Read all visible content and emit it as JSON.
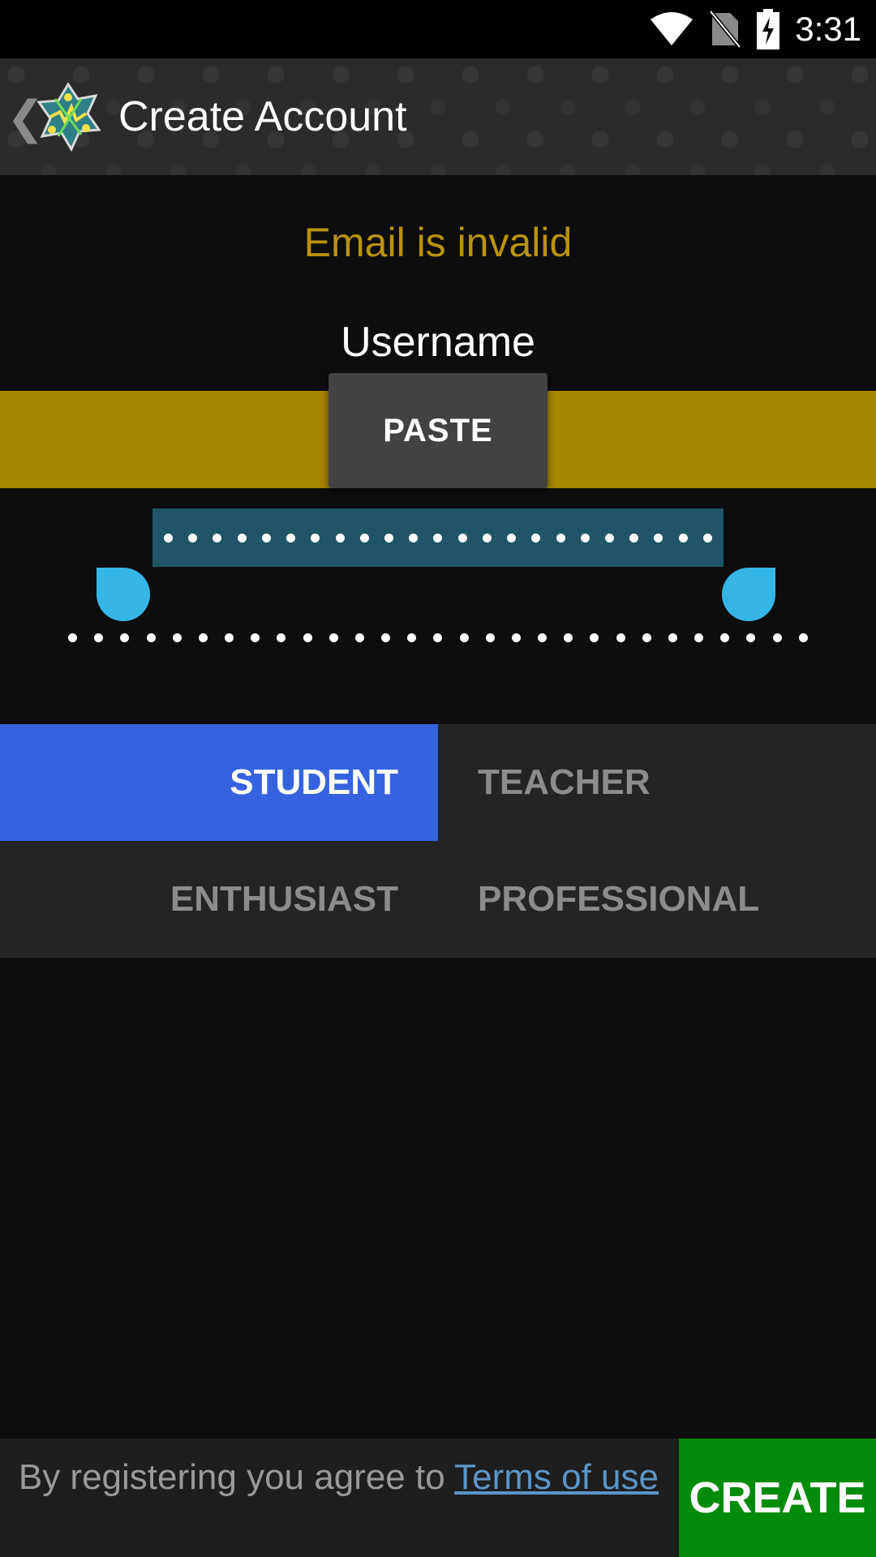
{
  "status_bar": {
    "time": "3:31",
    "icons": [
      "wifi-icon",
      "no-sim-icon",
      "battery-charging-icon"
    ]
  },
  "app_bar": {
    "title": "Create Account",
    "back_icon": "chevron-left-icon",
    "logo_icon": "app-logo-icon"
  },
  "form": {
    "error_message": "Email is invalid",
    "error_color": "#b8930f",
    "username_label": "Username",
    "username_field_color": "#a88700",
    "paste_label": "PASTE",
    "selection_color": "#1f5566",
    "handle_color": "#35b6e6"
  },
  "roles": {
    "options": [
      {
        "label": "STUDENT",
        "selected": true
      },
      {
        "label": "TEACHER",
        "selected": false
      },
      {
        "label": "ENTHUSIAST",
        "selected": false
      },
      {
        "label": "PROFESSIONAL",
        "selected": false
      }
    ],
    "selected_color": "#3563e0"
  },
  "footer": {
    "terms_prefix": "By registering you agree to ",
    "terms_link": "Terms of use",
    "create_label": "CREATE",
    "create_color": "#038c0b"
  }
}
